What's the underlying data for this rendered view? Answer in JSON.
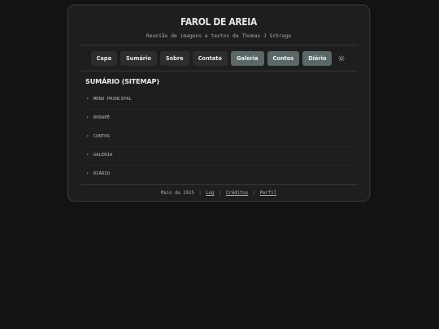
{
  "site": {
    "title": "FAROL DE AREIA",
    "tagline": "Reunião de imagens e textos de Thomas J Schrage"
  },
  "nav": {
    "items": [
      {
        "label": "Capa",
        "active": false
      },
      {
        "label": "Sumário",
        "active": false
      },
      {
        "label": "Sobre",
        "active": false
      },
      {
        "label": "Contato",
        "active": false
      },
      {
        "label": "Galeria",
        "active": true
      },
      {
        "label": "Contos",
        "active": true
      },
      {
        "label": "Diário",
        "active": true
      }
    ],
    "theme_icon": "sun-icon"
  },
  "section": {
    "title": "SUMÁRIO (SITEMAP)",
    "items": [
      {
        "bullet": "•",
        "label": "MENU PRINCIPAL"
      },
      {
        "bullet": "•",
        "label": "RODAPÉ"
      },
      {
        "bullet": "•",
        "label": "CONTOS"
      },
      {
        "bullet": "•",
        "label": "GALERIA"
      },
      {
        "bullet": "•",
        "label": "DIÁRIO"
      }
    ]
  },
  "footer": {
    "date": "Maio de 2025",
    "separator": "|",
    "links": [
      "Log",
      "Créditos",
      "Perfil"
    ]
  },
  "colors": {
    "background": "#131313",
    "card": "#1e1e1e",
    "nav_button": "#2d2d2d",
    "nav_button_active": "#5b6868"
  }
}
